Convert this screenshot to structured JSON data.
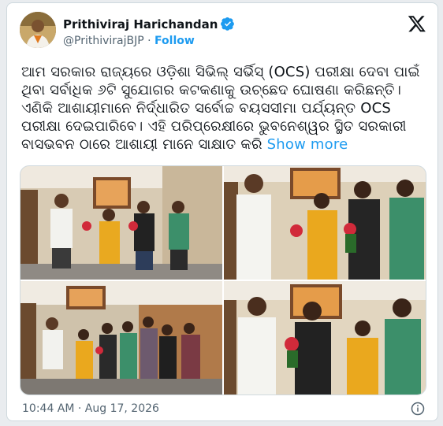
{
  "author": {
    "name": "Prithiviraj Harichandan",
    "handle": "@PrithivirajBJP",
    "separator": "·",
    "follow_label": "Follow"
  },
  "icons": {
    "verified": "verified-badge-icon",
    "platform": "x-logo-icon",
    "info": "info-icon"
  },
  "post": {
    "text": "ଆମ ସରକାର ରାଜ୍ୟରେ ଓଡ଼ିଶା ସିଭିଲ୍ ସର୍ଭିସ୍ (OCS) ପରୀକ୍ଷା ଦେବା ପାଇଁ ଥିବା ସର୍ବାଧିକ ୬ଟି ସୁଯୋଗର କଟକଣାକୁ ଉଚ୍ଛେଦ ଘୋଷଣା କରିଛନ୍ତି। ଏଣିକି ଆଶାୟୀମାନେ ନିର୍ଦ୍ଧାରିତ ସର୍ବୋଚ୍ଚ ବୟସସୀମା ପର୍ଯ୍ୟନ୍ତ OCS ପରୀକ୍ଷା ଦେଇପାରିବେ। ଏହି ପରିପ୍ରେକ୍ଷୀରେ ଭୁବନେଶ୍ୱର ସ୍ଥିତ ସରକାରୀ ବାସଭବନ ଠାରେ ଆଶାୟୀ ମାନେ ସାକ୍ଷାତ କରି",
    "show_more_label": "Show more",
    "timestamp": "10:44 AM · Aug 17, 2026"
  },
  "colors": {
    "accent": "#1d9bf0",
    "text": "#0f1419",
    "muted": "#536471",
    "border": "#cfd9de"
  }
}
